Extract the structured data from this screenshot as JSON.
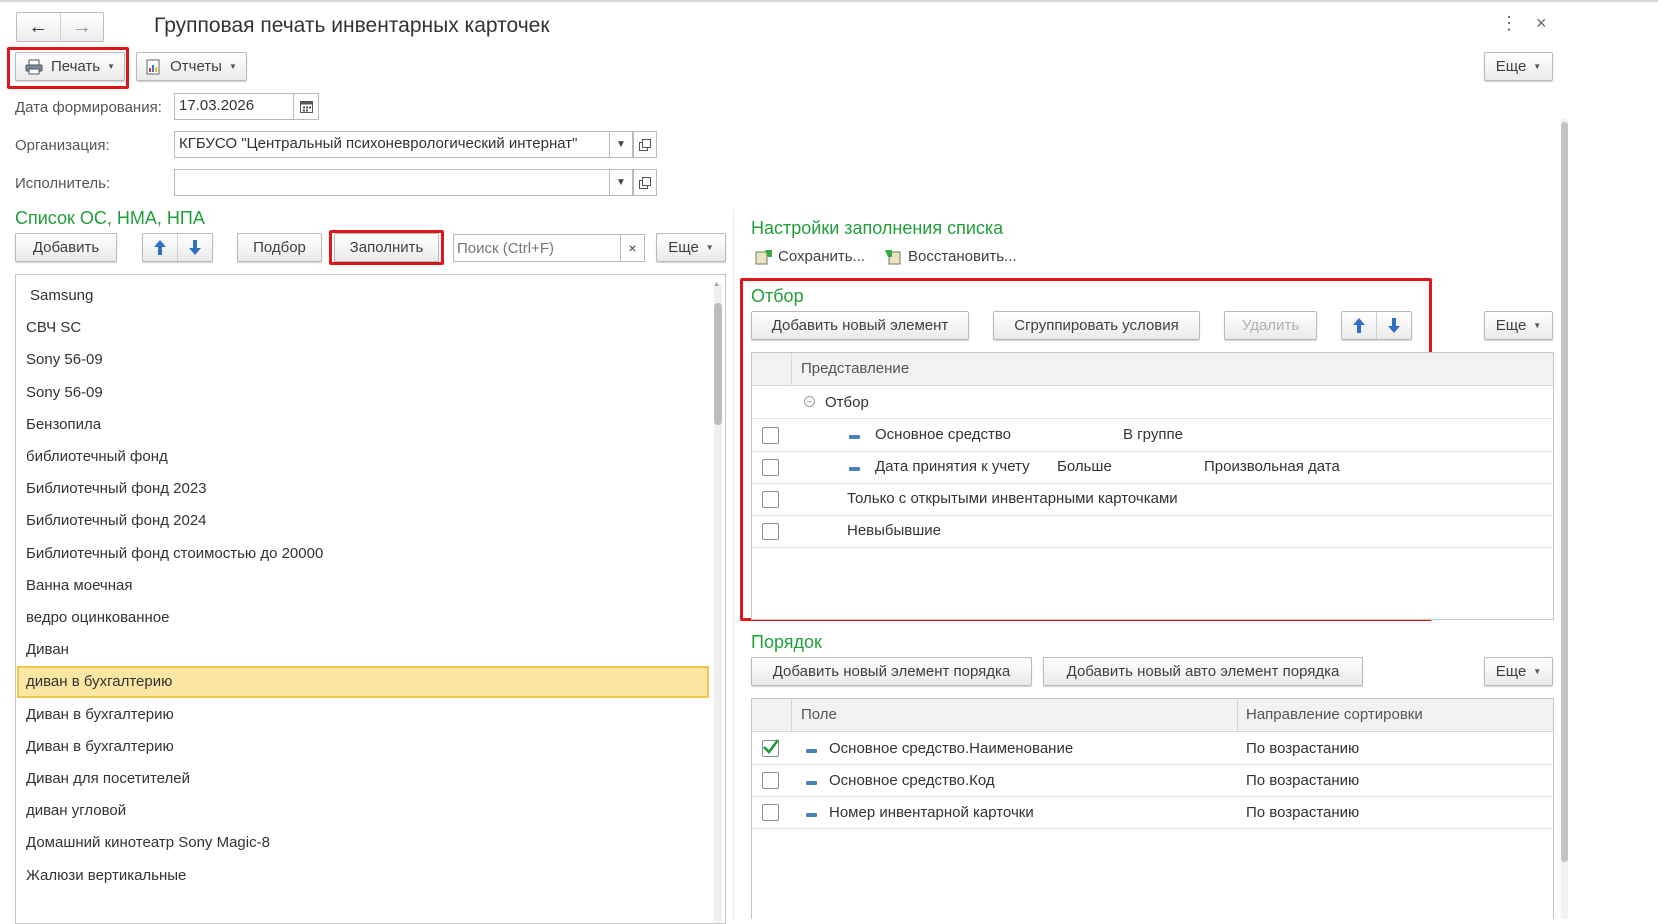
{
  "window": {
    "title": "Групповая печать инвентарных карточек"
  },
  "toolbar": {
    "print_label": "Печать",
    "reports_label": "Отчеты",
    "more_label": "Еще"
  },
  "form": {
    "date_label": "Дата формирования:",
    "date_value": "17.03.2026",
    "org_label": "Организация:",
    "org_value": "КГБУСО \"Центральный психоневрологический интернат\"",
    "executor_label": "Исполнитель:",
    "executor_value": ""
  },
  "left": {
    "title": "Список ОС, НМА, НПА",
    "add_label": "Добавить",
    "pick_label": "Подбор",
    "fill_label": "Заполнить",
    "search_placeholder": "Поиск (Ctrl+F)",
    "more_label": "Еще",
    "items": [
      "Samsung",
      "СВЧ SC",
      "Sony 56-09",
      "Sony 56-09",
      "Бензопила",
      "библиотечный фонд",
      "Библиотечный фонд 2023",
      "Библиотечный фонд 2024",
      "Библиотечный фонд стоимостью до 20000",
      "Ванна моечная",
      "ведро оцинкованное",
      "Диван",
      "диван в бухгалтерию",
      "Диван в бухгалтерию",
      "Диван в бухгалтерию",
      "Диван для посетителей",
      "диван угловой",
      "Домашний кинотеатр Sony Magic-8",
      "Жалюзи вертикальные"
    ],
    "selected_index": 12
  },
  "right": {
    "title": "Настройки заполнения списка",
    "save_label": "Сохранить...",
    "restore_label": "Восстановить...",
    "filter": {
      "title": "Отбор",
      "add_label": "Добавить новый элемент",
      "group_label": "Сгруппировать условия",
      "delete_label": "Удалить",
      "more_label": "Еще",
      "col_header": "Представление",
      "root_label": "Отбор",
      "rows": [
        {
          "field": "Основное средство",
          "condition": "В группе",
          "value": "",
          "checked": false
        },
        {
          "field": "Дата принятия к учету",
          "condition": "Больше",
          "value": "Произвольная дата",
          "checked": false
        },
        {
          "field": "Только с открытыми инвентарными карточками",
          "condition": "",
          "value": "",
          "checked": false
        },
        {
          "field": "Невыбывшие",
          "condition": "",
          "value": "",
          "checked": false
        }
      ]
    },
    "order": {
      "title": "Порядок",
      "add_label": "Добавить новый элемент порядка",
      "add_auto_label": "Добавить новый авто элемент порядка",
      "more_label": "Еще",
      "col_field": "Поле",
      "col_direction": "Направление сортировки",
      "rows": [
        {
          "field": "Основное средство.Наименование",
          "direction": "По возрастанию",
          "checked": true
        },
        {
          "field": "Основное средство.Код",
          "direction": "По возрастанию",
          "checked": false
        },
        {
          "field": "Номер инвентарной карточки",
          "direction": "По возрастанию",
          "checked": false
        }
      ]
    }
  },
  "colors": {
    "accent_green": "#21a03a",
    "highlight_red": "#e0161b",
    "selected_row": "#fbe7a3",
    "arrow_blue": "#2f6fc4"
  }
}
